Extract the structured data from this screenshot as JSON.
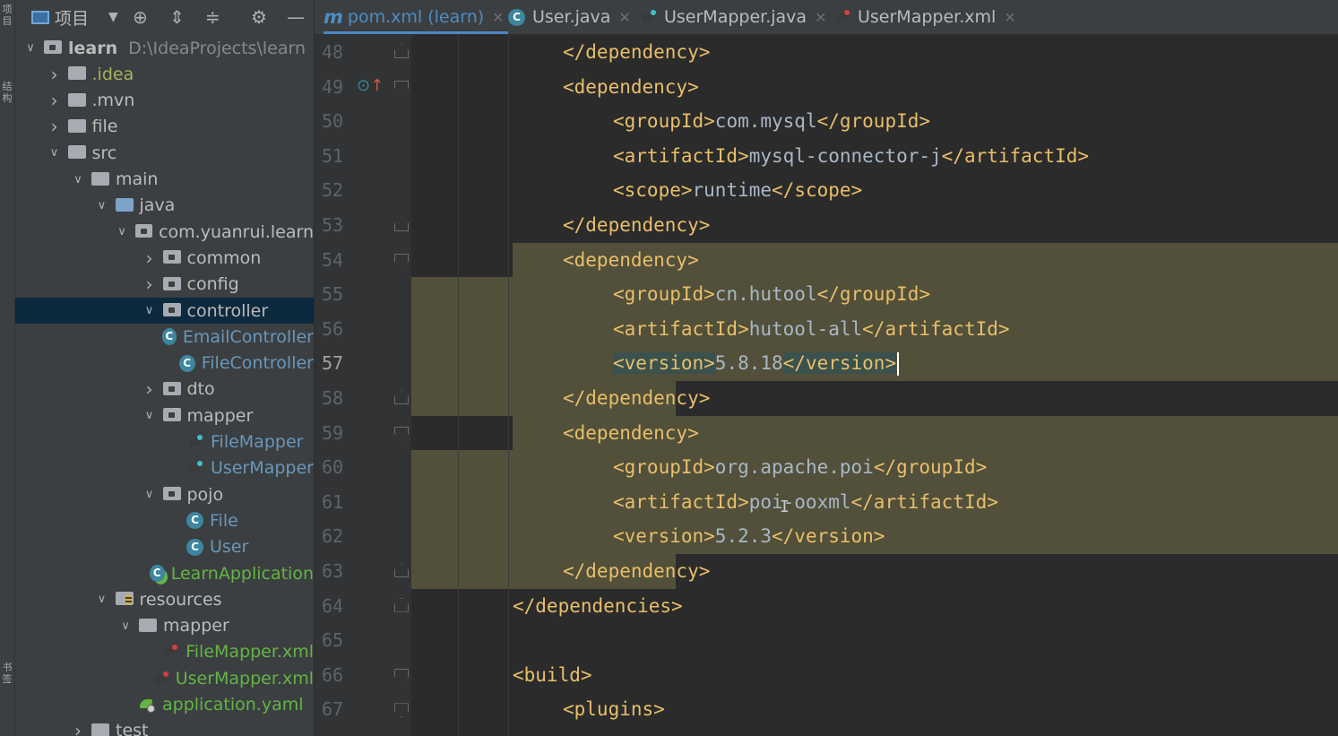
{
  "left_stripe": {
    "top_label": "项目",
    "mid_label": "结构",
    "bottom_label": "书签"
  },
  "project_panel": {
    "title": "项目",
    "tree": [
      {
        "label": "learn",
        "path": "D:\\IdeaProjects\\learn",
        "depth": 0,
        "type": "module",
        "expanded": true
      },
      {
        "label": ".idea",
        "depth": 1,
        "type": "folder",
        "expanded": false,
        "color": "olive"
      },
      {
        "label": ".mvn",
        "depth": 1,
        "type": "folder",
        "expanded": false
      },
      {
        "label": "file",
        "depth": 1,
        "type": "folder",
        "expanded": false
      },
      {
        "label": "src",
        "depth": 1,
        "type": "folder",
        "expanded": true
      },
      {
        "label": "main",
        "depth": 2,
        "type": "folder",
        "expanded": true
      },
      {
        "label": "java",
        "depth": 3,
        "type": "srcfolder",
        "expanded": true
      },
      {
        "label": "com.yuanrui.learn",
        "depth": 4,
        "type": "package",
        "expanded": true
      },
      {
        "label": "common",
        "depth": 5,
        "type": "package",
        "expanded": false
      },
      {
        "label": "config",
        "depth": 5,
        "type": "package",
        "expanded": false
      },
      {
        "label": "controller",
        "depth": 5,
        "type": "package",
        "expanded": true,
        "selected": true
      },
      {
        "label": "EmailController",
        "depth": 6,
        "type": "class",
        "color": "blue"
      },
      {
        "label": "FileController",
        "depth": 6,
        "type": "class",
        "color": "blue"
      },
      {
        "label": "dto",
        "depth": 5,
        "type": "package",
        "expanded": false
      },
      {
        "label": "mapper",
        "depth": 5,
        "type": "package",
        "expanded": true
      },
      {
        "label": "FileMapper",
        "depth": 6,
        "type": "mapper",
        "color": "blue"
      },
      {
        "label": "UserMapper",
        "depth": 6,
        "type": "mapper",
        "color": "blue"
      },
      {
        "label": "pojo",
        "depth": 5,
        "type": "package",
        "expanded": true
      },
      {
        "label": "File",
        "depth": 6,
        "type": "class",
        "color": "blue"
      },
      {
        "label": "User",
        "depth": 6,
        "type": "class",
        "color": "blue"
      },
      {
        "label": "LearnApplication",
        "depth": 5,
        "type": "appclass",
        "color": "green"
      },
      {
        "label": "resources",
        "depth": 3,
        "type": "resfolder",
        "expanded": true
      },
      {
        "label": "mapper",
        "depth": 4,
        "type": "folder",
        "expanded": true
      },
      {
        "label": "FileMapper.xml",
        "depth": 5,
        "type": "xml",
        "color": "green"
      },
      {
        "label": "UserMapper.xml",
        "depth": 5,
        "type": "xml",
        "color": "green"
      },
      {
        "label": "application.yaml",
        "depth": 4,
        "type": "yaml",
        "color": "green"
      },
      {
        "label": "test",
        "depth": 2,
        "type": "folder",
        "expanded": false
      }
    ]
  },
  "tabs": [
    {
      "label": "pom.xml (learn)",
      "icon": "maven-icon",
      "active": true
    },
    {
      "label": "User.java",
      "icon": "class-icon",
      "active": false
    },
    {
      "label": "UserMapper.java",
      "icon": "mybatis-icon",
      "active": false
    },
    {
      "label": "UserMapper.xml",
      "icon": "mybatis-xml-icon",
      "active": false
    }
  ],
  "editor": {
    "current_line": "57",
    "lines": [
      {
        "no": "48",
        "indent": 2,
        "parts": [
          [
            "tag",
            "</dependency>"
          ]
        ]
      },
      {
        "no": "49",
        "indent": 2,
        "parts": [
          [
            "tag",
            "<dependency>"
          ]
        ]
      },
      {
        "no": "50",
        "indent": 3,
        "parts": [
          [
            "tag",
            "<groupId>"
          ],
          [
            "val",
            "com.mysql"
          ],
          [
            "tag",
            "</groupId>"
          ]
        ]
      },
      {
        "no": "51",
        "indent": 3,
        "parts": [
          [
            "tag",
            "<artifactId>"
          ],
          [
            "val",
            "mysql-connector-j"
          ],
          [
            "tag",
            "</artifactId>"
          ]
        ]
      },
      {
        "no": "52",
        "indent": 3,
        "parts": [
          [
            "tag",
            "<scope>"
          ],
          [
            "val",
            "runtime"
          ],
          [
            "tag",
            "</scope>"
          ]
        ]
      },
      {
        "no": "53",
        "indent": 2,
        "parts": [
          [
            "tag",
            "</dependency>"
          ]
        ]
      },
      {
        "no": "54",
        "indent": 2,
        "parts": [
          [
            "tag",
            "<dependency>"
          ]
        ]
      },
      {
        "no": "55",
        "indent": 3,
        "parts": [
          [
            "tag",
            "<groupId>"
          ],
          [
            "val",
            "cn.hutool"
          ],
          [
            "tag",
            "</groupId>"
          ]
        ]
      },
      {
        "no": "56",
        "indent": 3,
        "parts": [
          [
            "tag",
            "<artifactId>"
          ],
          [
            "val",
            "hutool-all"
          ],
          [
            "tag",
            "</artifactId>"
          ]
        ]
      },
      {
        "no": "57",
        "indent": 3,
        "parts": [
          [
            "tagm",
            "<version>"
          ],
          [
            "val",
            "5.8.18"
          ],
          [
            "tagm",
            "</version>"
          ]
        ],
        "caret": true
      },
      {
        "no": "58",
        "indent": 2,
        "parts": [
          [
            "tag",
            "</dependency>"
          ]
        ]
      },
      {
        "no": "59",
        "indent": 2,
        "parts": [
          [
            "tag",
            "<dependency>"
          ]
        ]
      },
      {
        "no": "60",
        "indent": 3,
        "parts": [
          [
            "tag",
            "<groupId>"
          ],
          [
            "val",
            "org.apache.poi"
          ],
          [
            "tag",
            "</groupId>"
          ]
        ]
      },
      {
        "no": "61",
        "indent": 3,
        "parts": [
          [
            "tag",
            "<artifactId>"
          ],
          [
            "val",
            "poi-ooxml"
          ],
          [
            "tag",
            "</artifactId>"
          ]
        ]
      },
      {
        "no": "62",
        "indent": 3,
        "parts": [
          [
            "tag",
            "<version>"
          ],
          [
            "val",
            "5.2.3"
          ],
          [
            "tag",
            "</version>"
          ]
        ]
      },
      {
        "no": "63",
        "indent": 2,
        "parts": [
          [
            "tag",
            "</dependency>"
          ]
        ]
      },
      {
        "no": "64",
        "indent": 1,
        "parts": [
          [
            "tag",
            "</dependencies>"
          ]
        ]
      },
      {
        "no": "65",
        "indent": 0,
        "parts": []
      },
      {
        "no": "66",
        "indent": 1,
        "parts": [
          [
            "tag",
            "<build>"
          ]
        ]
      },
      {
        "no": "67",
        "indent": 2,
        "parts": [
          [
            "tag",
            "<plugins>"
          ]
        ]
      }
    ]
  },
  "colors": {
    "tag": "#e8bf6a",
    "value": "#a9b7c6",
    "selection": "#52503a",
    "accent": "#4a88c7"
  }
}
